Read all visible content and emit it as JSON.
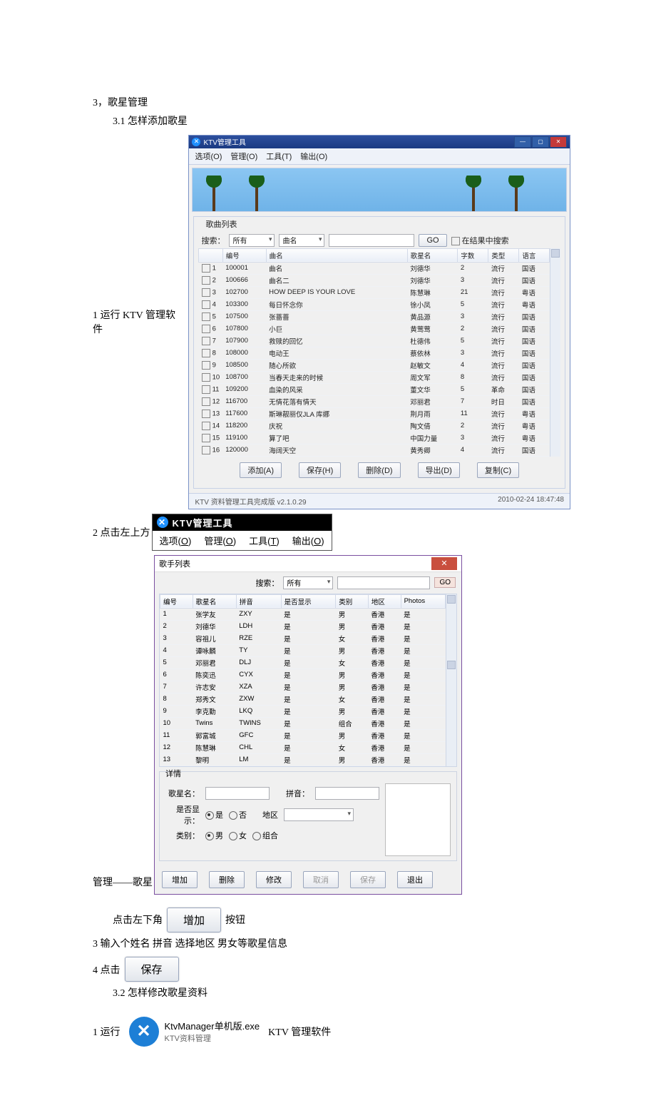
{
  "doc": {
    "sec_num": "3，",
    "sec_title": "歌星管理",
    "sub31": "3.1 怎样添加歌星",
    "step1_prefix": "1 运行 KTV 管理软件",
    "step2_prefix": "2 点击左上方",
    "guanli_gexing": "管理——歌星",
    "click_lowerleft": "点击左下角",
    "btn_suffix": "按钮",
    "step3": "3 输入个姓名 拼音 选择地区 男女等歌星信息",
    "step4_prefix": "4 点击",
    "sub32": "3.2 怎样修改歌星资料",
    "run_prefix": "1 运行",
    "run_suffix": "KTV 管理软件"
  },
  "win1": {
    "title": "KTV管理工具",
    "menu": [
      "选项(O)",
      "管理(O)",
      "工具(T)",
      "输出(O)"
    ],
    "group": "歌曲列表",
    "search_label": "搜索：",
    "filter1": "所有",
    "filter2": "曲名",
    "go": "GO",
    "cb_results": "在结果中搜索",
    "cols": [
      "",
      "编号",
      "曲名",
      "歌星名",
      "字数",
      "类型",
      "语言",
      ""
    ],
    "rows": [
      [
        "1",
        "100001",
        "曲名",
        "刘德华",
        "2",
        "流行",
        "国语"
      ],
      [
        "2",
        "100666",
        "曲名二",
        "刘德华",
        "3",
        "流行",
        "国语"
      ],
      [
        "3",
        "102700",
        "HOW DEEP IS YOUR LOVE",
        "陈慧琳",
        "21",
        "流行",
        "粤语"
      ],
      [
        "4",
        "103300",
        "每日怀念你",
        "徐小凤",
        "5",
        "流行",
        "粤语"
      ],
      [
        "5",
        "107500",
        "张蔷蔷",
        "黄品源",
        "3",
        "流行",
        "国语"
      ],
      [
        "6",
        "107800",
        "小巨",
        "黄莺莺",
        "2",
        "流行",
        "国语"
      ],
      [
        "7",
        "107900",
        "救赎的回忆",
        "杜德伟",
        "5",
        "流行",
        "国语"
      ],
      [
        "8",
        "108000",
        "电动王",
        "蔡依林",
        "3",
        "流行",
        "国语"
      ],
      [
        "9",
        "108500",
        "随心所欲",
        "赵敏文",
        "4",
        "流行",
        "国语"
      ],
      [
        "10",
        "108700",
        "当春天走来的时候",
        "周文军",
        "8",
        "流行",
        "国语"
      ],
      [
        "11",
        "109200",
        "血染的风采",
        "董文华",
        "5",
        "革命",
        "国语"
      ],
      [
        "12",
        "116700",
        "无情花落有情天",
        "邓丽君",
        "7",
        "时日",
        "国语"
      ],
      [
        "13",
        "117600",
        "斯琳靓丽仅JLA 库娜",
        "荆月雨",
        "11",
        "流行",
        "粤语"
      ],
      [
        "14",
        "118200",
        "庆祝",
        "陶文倩",
        "2",
        "流行",
        "粤语"
      ],
      [
        "15",
        "119100",
        "算了吧",
        "中国力量",
        "3",
        "流行",
        "粤语"
      ],
      [
        "16",
        "120000",
        "海阔天空",
        "黄秀卿",
        "4",
        "流行",
        "国语"
      ]
    ],
    "btns": [
      "添加(A)",
      "保存(H)",
      "删除(D)",
      "导出(D)",
      "复制(C)"
    ],
    "status_left": "KTV 资料管理工具完成版 v2.1.0.29",
    "status_right": "2010-02-24 18:47:48"
  },
  "strip": {
    "title": "KTV管理工具",
    "items": [
      "选项(O)",
      "管理(O)",
      "工具(T)",
      "输出(O)"
    ]
  },
  "dlg": {
    "title": "歌手列表",
    "search": "搜索：",
    "filter": "所有",
    "go": "GO",
    "cols": [
      "编号",
      "歌星名",
      "拼音",
      "是否显示",
      "类别",
      "地区",
      "Photos"
    ],
    "rows": [
      [
        "1",
        "张学友",
        "ZXY",
        "是",
        "男",
        "香港",
        "是"
      ],
      [
        "2",
        "刘德华",
        "LDH",
        "是",
        "男",
        "香港",
        "是"
      ],
      [
        "3",
        "容祖儿",
        "RZE",
        "是",
        "女",
        "香港",
        "是"
      ],
      [
        "4",
        "谭咏麟",
        "TY",
        "是",
        "男",
        "香港",
        "是"
      ],
      [
        "5",
        "邓丽君",
        "DLJ",
        "是",
        "女",
        "香港",
        "是"
      ],
      [
        "6",
        "陈奕迅",
        "CYX",
        "是",
        "男",
        "香港",
        "是"
      ],
      [
        "7",
        "许志安",
        "XZA",
        "是",
        "男",
        "香港",
        "是"
      ],
      [
        "8",
        "郑秀文",
        "ZXW",
        "是",
        "女",
        "香港",
        "是"
      ],
      [
        "9",
        "李克勤",
        "LKQ",
        "是",
        "男",
        "香港",
        "是"
      ],
      [
        "10",
        "Twins",
        "TWINS",
        "是",
        "组合",
        "香港",
        "是"
      ],
      [
        "11",
        "郭富城",
        "GFC",
        "是",
        "男",
        "香港",
        "是"
      ],
      [
        "12",
        "陈慧琳",
        "CHL",
        "是",
        "女",
        "香港",
        "是"
      ],
      [
        "13",
        "黎明",
        "LM",
        "是",
        "男",
        "香港",
        "是"
      ]
    ],
    "details": "详情",
    "f_name": "歌星名：",
    "f_pinyin": "拼音：",
    "f_show": "是否显示：",
    "r_yes": "是",
    "r_no": "否",
    "f_region": "地区",
    "f_cat": "类别：",
    "r_m": "男",
    "r_f": "女",
    "r_g": "组合",
    "btns": [
      "增加",
      "删除",
      "修改",
      "取消",
      "保存",
      "退出"
    ]
  },
  "btn_add": "增加",
  "btn_save": "保存",
  "exe": {
    "name": "KtvManager单机版.exe",
    "desc": "KTV资料管理"
  }
}
